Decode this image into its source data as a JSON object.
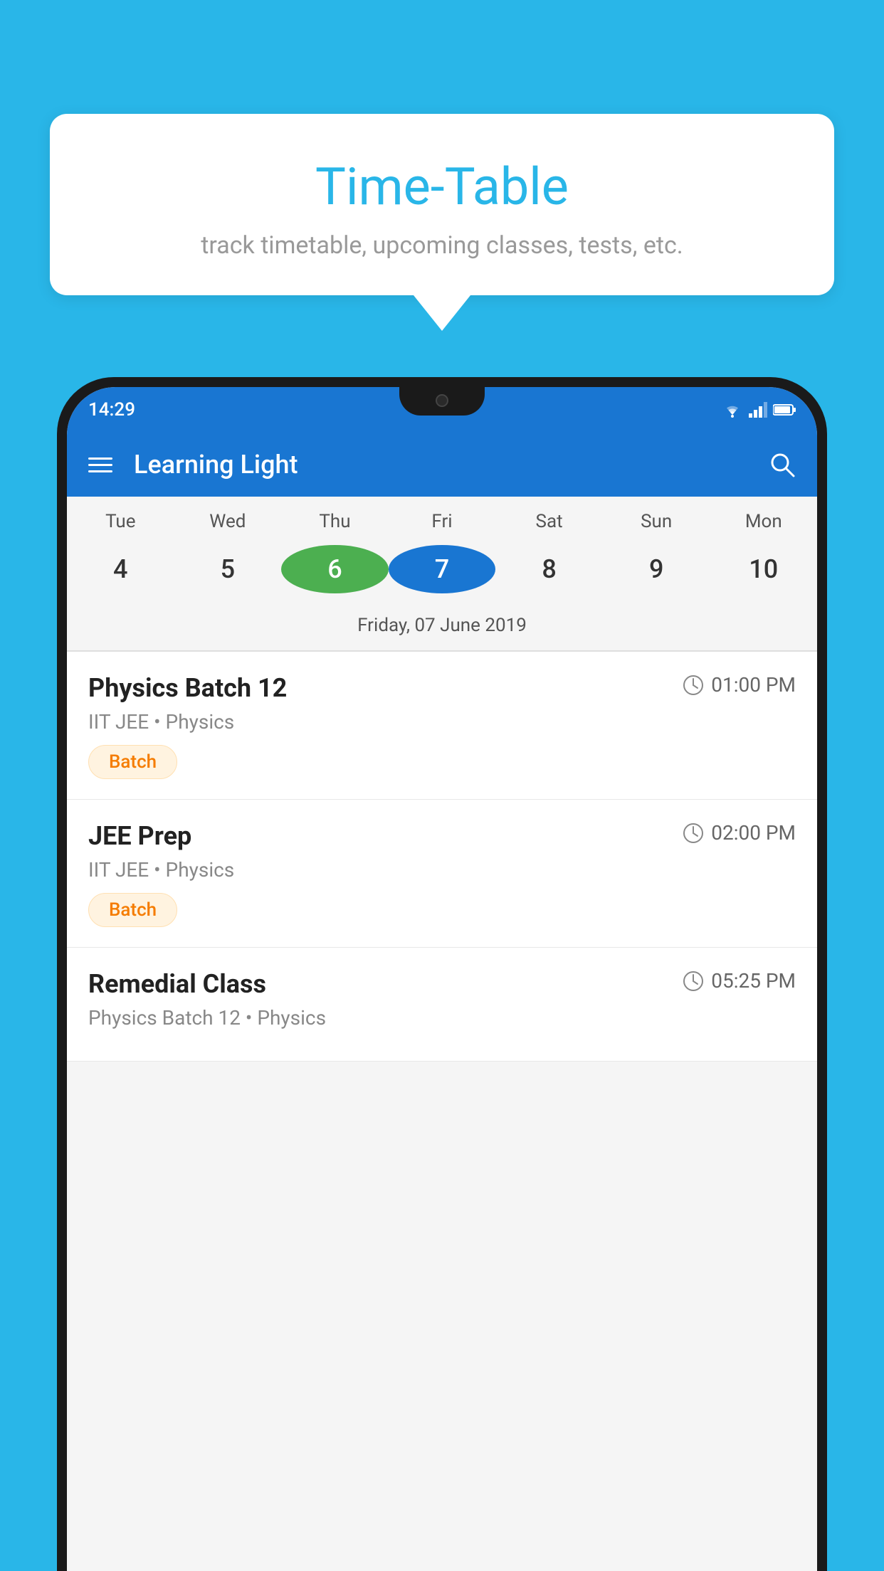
{
  "page": {
    "background_color": "#29b6e8"
  },
  "speech_bubble": {
    "title": "Time-Table",
    "subtitle": "track timetable, upcoming classes, tests, etc."
  },
  "status_bar": {
    "time": "14:29"
  },
  "app_bar": {
    "title": "Learning Light",
    "search_icon": "search"
  },
  "calendar": {
    "days": [
      {
        "name": "Tue",
        "number": "4"
      },
      {
        "name": "Wed",
        "number": "5"
      },
      {
        "name": "Thu",
        "number": "6",
        "today": true
      },
      {
        "name": "Fri",
        "number": "7",
        "selected": true
      },
      {
        "name": "Sat",
        "number": "8"
      },
      {
        "name": "Sun",
        "number": "9"
      },
      {
        "name": "Mon",
        "number": "10"
      }
    ],
    "selected_date_label": "Friday, 07 June 2019"
  },
  "events": [
    {
      "title": "Physics Batch 12",
      "time": "01:00 PM",
      "subtitle": "IIT JEE • Physics",
      "badge": "Batch"
    },
    {
      "title": "JEE Prep",
      "time": "02:00 PM",
      "subtitle": "IIT JEE • Physics",
      "badge": "Batch"
    },
    {
      "title": "Remedial Class",
      "time": "05:25 PM",
      "subtitle": "Physics Batch 12 • Physics",
      "badge": ""
    }
  ],
  "icons": {
    "hamburger": "☰",
    "search": "🔍"
  }
}
